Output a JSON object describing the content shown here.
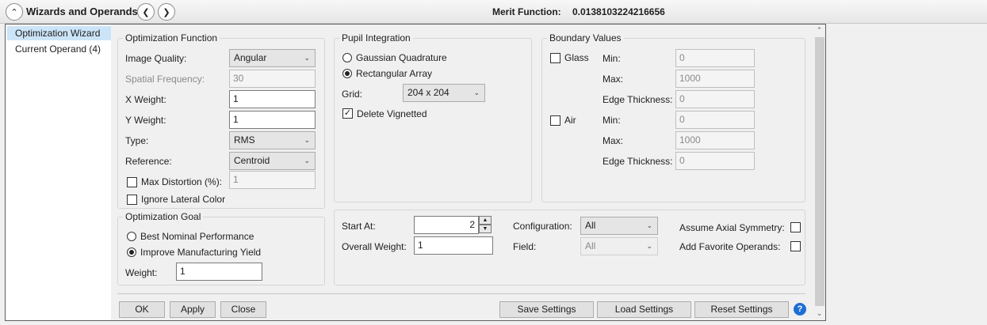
{
  "titlebar": {
    "title": "Wizards and Operands",
    "merit_label": "Merit Function:",
    "merit_value": "0.0138103224216656"
  },
  "nav": {
    "items": [
      {
        "label": "Optimization Wizard"
      },
      {
        "label": "Current Operand (4)"
      }
    ]
  },
  "optimization_function": {
    "legend": "Optimization Function",
    "image_quality_label": "Image Quality:",
    "image_quality_value": "Angular",
    "spatial_frequency_label": "Spatial Frequency:",
    "spatial_frequency_value": "30",
    "x_weight_label": "X Weight:",
    "x_weight_value": "1",
    "y_weight_label": "Y Weight:",
    "y_weight_value": "1",
    "type_label": "Type:",
    "type_value": "RMS",
    "reference_label": "Reference:",
    "reference_value": "Centroid",
    "max_distortion_label": "Max Distortion (%):",
    "max_distortion_value": "1",
    "ignore_lateral_label": "Ignore Lateral Color"
  },
  "optimization_goal": {
    "legend": "Optimization Goal",
    "best_nominal_label": "Best Nominal Performance",
    "improve_yield_label": "Improve Manufacturing Yield",
    "weight_label": "Weight:",
    "weight_value": "1"
  },
  "pupil_integration": {
    "legend": "Pupil Integration",
    "gaussian_label": "Gaussian Quadrature",
    "rectangular_label": "Rectangular Array",
    "grid_label": "Grid:",
    "grid_value": "204 x 204",
    "delete_vignetted_label": "Delete Vignetted"
  },
  "boundary_values": {
    "legend": "Boundary Values",
    "glass_label": "Glass",
    "glass_min_label": "Min:",
    "glass_min_value": "0",
    "glass_max_label": "Max:",
    "glass_max_value": "1000",
    "glass_edge_label": "Edge Thickness:",
    "glass_edge_value": "0",
    "air_label": "Air",
    "air_min_label": "Min:",
    "air_min_value": "0",
    "air_max_label": "Max:",
    "air_max_value": "1000",
    "air_edge_label": "Edge Thickness:",
    "air_edge_value": "0"
  },
  "bottom_group": {
    "start_at_label": "Start At:",
    "start_at_value": "2",
    "overall_weight_label": "Overall Weight:",
    "overall_weight_value": "1",
    "configuration_label": "Configuration:",
    "configuration_value": "All",
    "field_label": "Field:",
    "field_value": "All",
    "assume_axial_label": "Assume Axial Symmetry:",
    "add_favorite_label": "Add Favorite Operands:"
  },
  "buttons": {
    "ok": "OK",
    "apply": "Apply",
    "close": "Close",
    "save_settings": "Save Settings",
    "load_settings": "Load Settings",
    "reset_settings": "Reset Settings",
    "help": "?"
  },
  "icons": {
    "collapse": "chevron-up-icon",
    "prev": "chevron-left-icon",
    "next": "chevron-right-icon"
  }
}
